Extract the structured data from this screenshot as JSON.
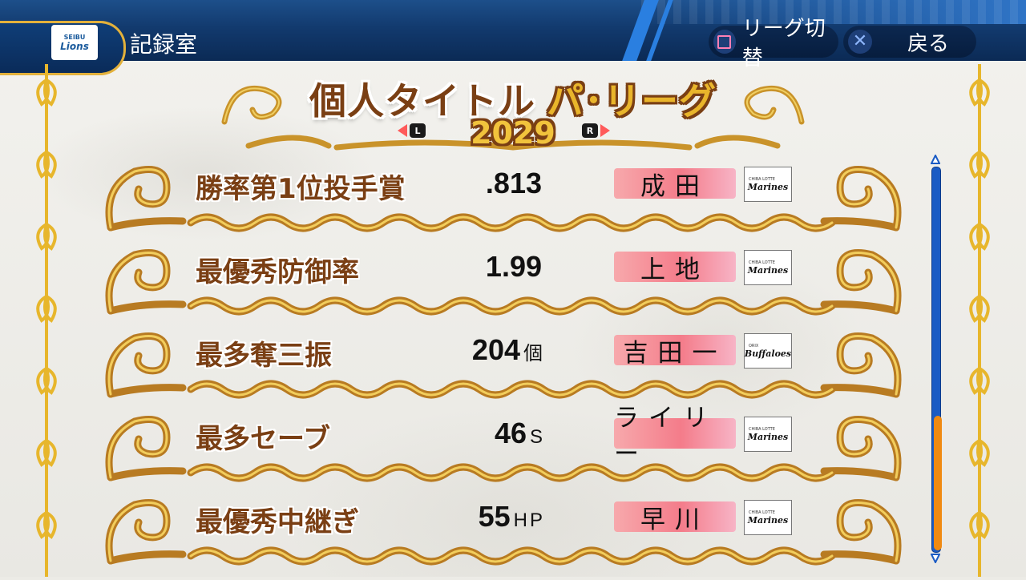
{
  "header": {
    "screen_title": "記録室",
    "team_logo_top": "SEIBU",
    "team_logo_name": "Lions",
    "buttons": [
      {
        "icon": "square-button-icon",
        "label": "リーグ切替"
      },
      {
        "icon": "cross-button-icon",
        "label": "戻る"
      }
    ]
  },
  "page": {
    "title": "個人タイトル",
    "league": "パ･リーグ",
    "year": "2029",
    "prev_key": "L",
    "next_key": "R"
  },
  "awards": [
    {
      "title": "勝率第1位投手賞",
      "value": ".813",
      "unit": "",
      "player": "成田",
      "team_top": "CHIBA LOTTE",
      "team": "Marines"
    },
    {
      "title": "最優秀防御率",
      "value": "1.99",
      "unit": "",
      "player": "上地",
      "team_top": "CHIBA LOTTE",
      "team": "Marines"
    },
    {
      "title": "最多奪三振",
      "value": "204",
      "unit": "個",
      "player": "吉田一",
      "team_top": "ORIX",
      "team": "Buffaloes"
    },
    {
      "title": "最多セーブ",
      "value": "46",
      "unit": "S",
      "player": "ライリー",
      "team_top": "CHIBA LOTTE",
      "team": "Marines"
    },
    {
      "title": "最優秀中継ぎ",
      "value": "55",
      "unit": "HP",
      "player": "早川",
      "team_top": "CHIBA LOTTE",
      "team": "Marines"
    }
  ],
  "scroll": {
    "position": 0.64,
    "visible_fraction": 0.35
  },
  "colors": {
    "accent_gold": "#e3b13b",
    "label_brown": "#7a3f14",
    "name_pink": "#f47c8a",
    "scroll_blue": "#1a5bc4",
    "scroll_thumb": "#f08a12"
  }
}
